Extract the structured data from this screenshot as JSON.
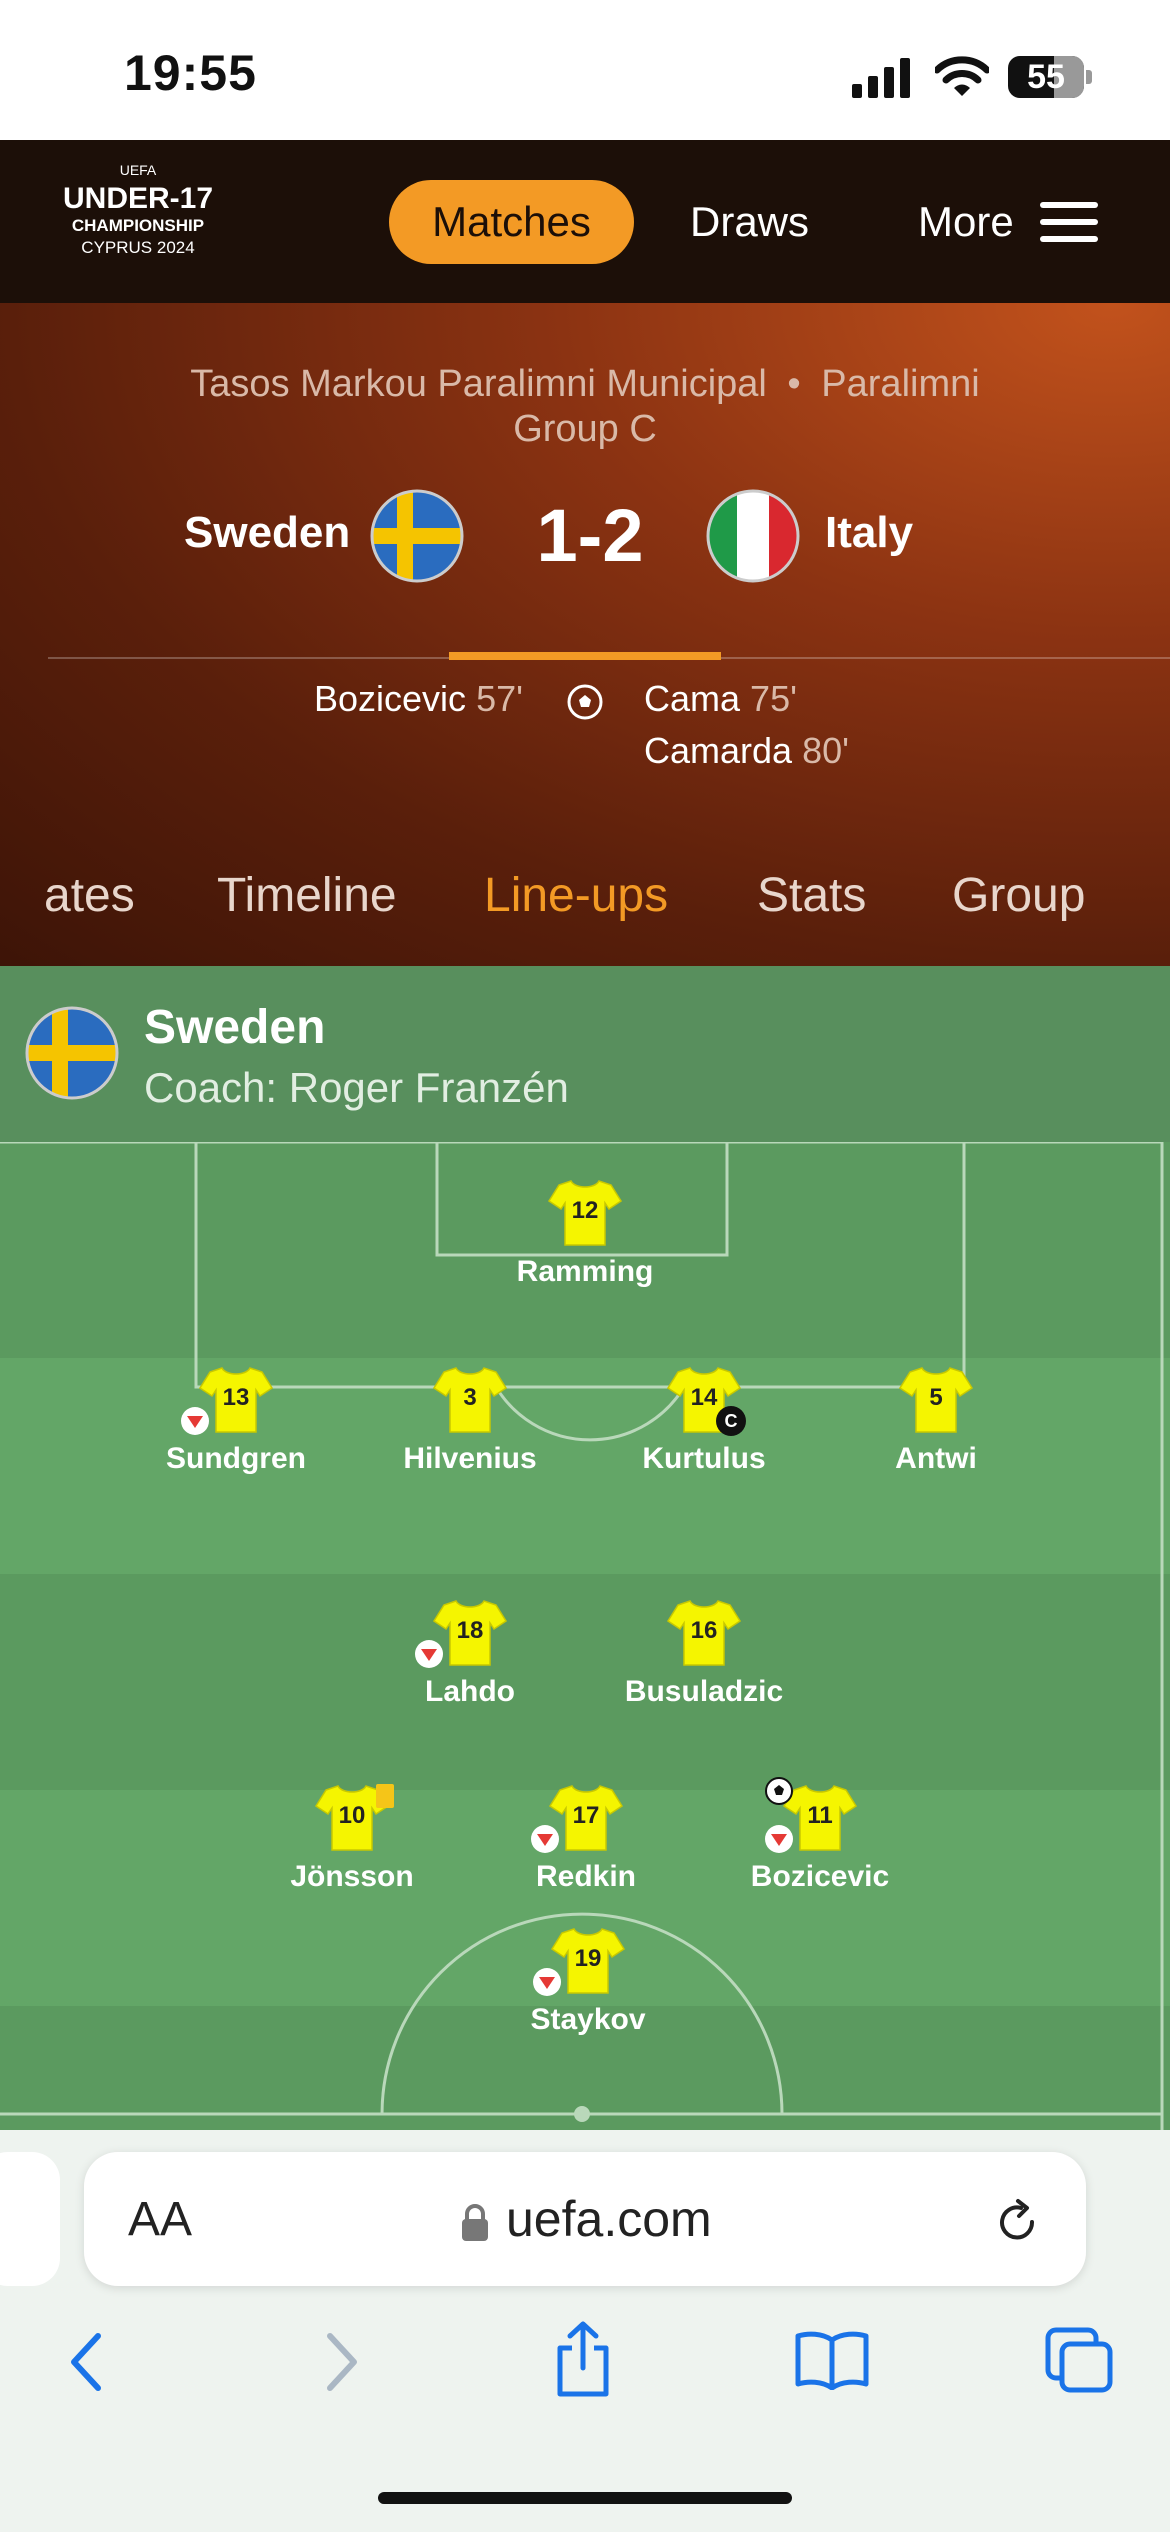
{
  "status_bar": {
    "time": "19:55",
    "battery": "55"
  },
  "header": {
    "logo": {
      "line1": "UEFA",
      "line2": "UNDER-17",
      "line3": "CHAMPIONSHIP",
      "line4": "CYPRUS 2024"
    },
    "nav": {
      "matches": "Matches",
      "draws": "Draws",
      "more": "More"
    }
  },
  "match": {
    "venue": "Tasos Markou Paralimni Municipal",
    "separator": "•",
    "city": "Paralimni",
    "group": "Group C",
    "home": {
      "name": "Sweden"
    },
    "away": {
      "name": "Italy"
    },
    "score": "1-2",
    "home_scorers": [
      {
        "name": "Bozicevic",
        "minute": "57'"
      }
    ],
    "away_scorers": [
      {
        "name": "Cama",
        "minute": "75'"
      },
      {
        "name": "Camarda",
        "minute": "80'"
      }
    ]
  },
  "tabs": [
    "ates",
    "Timeline",
    "Line-ups",
    "Stats",
    "Group"
  ],
  "active_tab": "Line-ups",
  "lineup": {
    "team": "Sweden",
    "coach": "Coach: Roger Franzén",
    "players": [
      {
        "num": "12",
        "name": "Ramming"
      },
      {
        "num": "13",
        "name": "Sundgren",
        "subbed": true
      },
      {
        "num": "3",
        "name": "Hilvenius"
      },
      {
        "num": "14",
        "name": "Kurtulus",
        "captain": true,
        "captain_label": "C"
      },
      {
        "num": "5",
        "name": "Antwi"
      },
      {
        "num": "18",
        "name": "Lahdo",
        "subbed": true
      },
      {
        "num": "16",
        "name": "Busuladzic"
      },
      {
        "num": "10",
        "name": "Jönsson",
        "yellow_card": true
      },
      {
        "num": "17",
        "name": "Redkin",
        "subbed": true
      },
      {
        "num": "11",
        "name": "Bozicevic",
        "subbed": true,
        "goal": true
      },
      {
        "num": "19",
        "name": "Staykov",
        "subbed": true
      }
    ]
  },
  "browser": {
    "text_size": "AA",
    "url": "uefa.com"
  },
  "colors": {
    "accent": "#f39a25",
    "header_bg": "#1c0f08",
    "shirt": "#f5f500",
    "pitch_light": "#62a566",
    "pitch_dark": "#588f5d"
  }
}
